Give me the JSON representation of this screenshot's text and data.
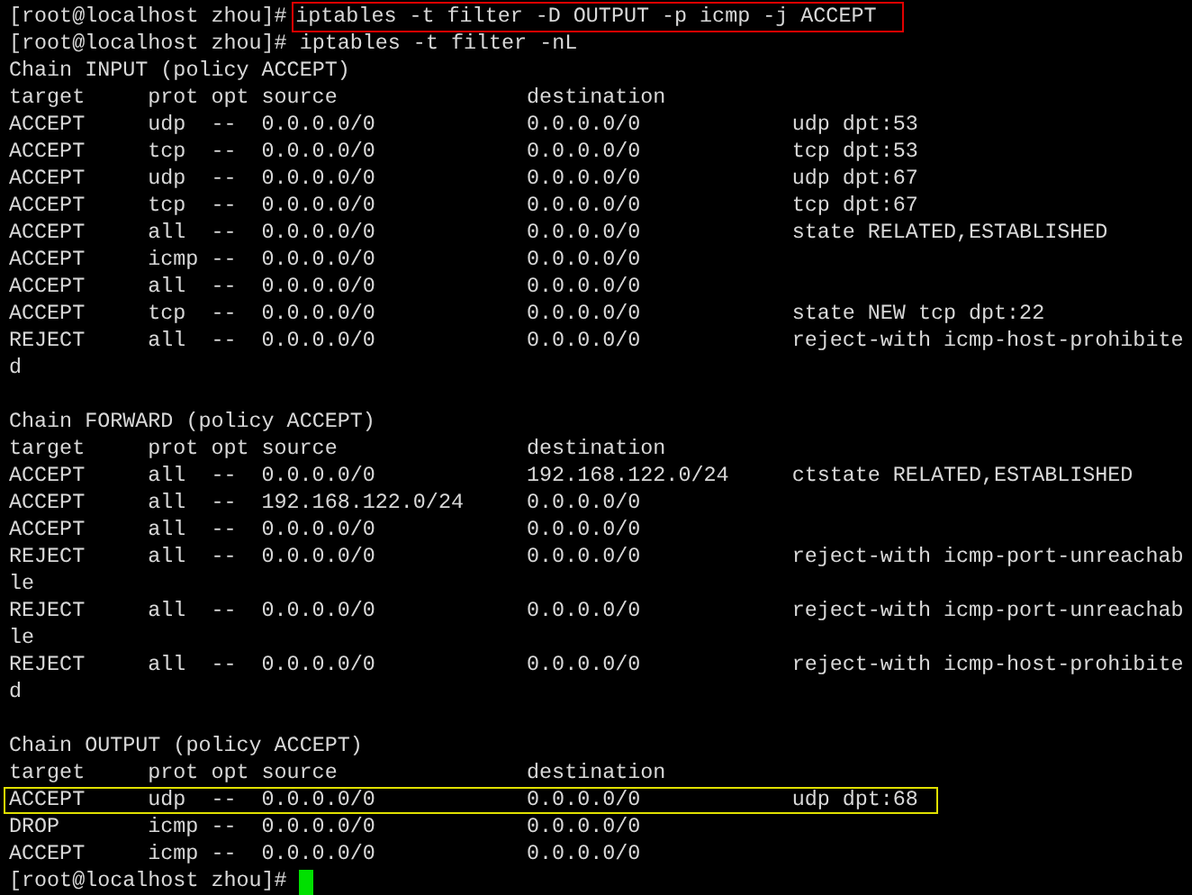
{
  "terminal": {
    "lines": [
      {
        "kind": "command",
        "prompt": "[root@localhost zhou]#",
        "command": "iptables -t filter -D OUTPUT -p icmp -j ACCEPT",
        "highlighted": true
      },
      {
        "kind": "command",
        "prompt": "[root@localhost zhou]#",
        "command": "iptables -t filter -nL"
      },
      {
        "kind": "text",
        "text": "Chain INPUT (policy ACCEPT)"
      },
      {
        "kind": "row",
        "cells": [
          "target",
          "prot",
          "opt",
          "source",
          "destination"
        ]
      },
      {
        "kind": "row",
        "cells": [
          "ACCEPT",
          "udp",
          "--",
          "0.0.0.0/0",
          "0.0.0.0/0",
          "udp dpt:53"
        ]
      },
      {
        "kind": "row",
        "cells": [
          "ACCEPT",
          "tcp",
          "--",
          "0.0.0.0/0",
          "0.0.0.0/0",
          "tcp dpt:53"
        ]
      },
      {
        "kind": "row",
        "cells": [
          "ACCEPT",
          "udp",
          "--",
          "0.0.0.0/0",
          "0.0.0.0/0",
          "udp dpt:67"
        ]
      },
      {
        "kind": "row",
        "cells": [
          "ACCEPT",
          "tcp",
          "--",
          "0.0.0.0/0",
          "0.0.0.0/0",
          "tcp dpt:67"
        ]
      },
      {
        "kind": "row",
        "cells": [
          "ACCEPT",
          "all",
          "--",
          "0.0.0.0/0",
          "0.0.0.0/0",
          "state RELATED,ESTABLISHED"
        ]
      },
      {
        "kind": "row",
        "cells": [
          "ACCEPT",
          "icmp",
          "--",
          "0.0.0.0/0",
          "0.0.0.0/0"
        ]
      },
      {
        "kind": "row",
        "cells": [
          "ACCEPT",
          "all",
          "--",
          "0.0.0.0/0",
          "0.0.0.0/0"
        ]
      },
      {
        "kind": "row",
        "cells": [
          "ACCEPT",
          "tcp",
          "--",
          "0.0.0.0/0",
          "0.0.0.0/0",
          "state NEW tcp dpt:22"
        ]
      },
      {
        "kind": "row",
        "cells": [
          "REJECT",
          "all",
          "--",
          "0.0.0.0/0",
          "0.0.0.0/0",
          "reject-with icmp-host-prohibite"
        ]
      },
      {
        "kind": "text",
        "text": "d"
      },
      {
        "kind": "blank"
      },
      {
        "kind": "text",
        "text": "Chain FORWARD (policy ACCEPT)"
      },
      {
        "kind": "row",
        "cells": [
          "target",
          "prot",
          "opt",
          "source",
          "destination"
        ]
      },
      {
        "kind": "row",
        "cells": [
          "ACCEPT",
          "all",
          "--",
          "0.0.0.0/0",
          "192.168.122.0/24",
          "ctstate RELATED,ESTABLISHED"
        ]
      },
      {
        "kind": "row",
        "cells": [
          "ACCEPT",
          "all",
          "--",
          "192.168.122.0/24",
          "0.0.0.0/0"
        ]
      },
      {
        "kind": "row",
        "cells": [
          "ACCEPT",
          "all",
          "--",
          "0.0.0.0/0",
          "0.0.0.0/0"
        ]
      },
      {
        "kind": "row",
        "cells": [
          "REJECT",
          "all",
          "--",
          "0.0.0.0/0",
          "0.0.0.0/0",
          "reject-with icmp-port-unreachab"
        ]
      },
      {
        "kind": "text",
        "text": "le"
      },
      {
        "kind": "row",
        "cells": [
          "REJECT",
          "all",
          "--",
          "0.0.0.0/0",
          "0.0.0.0/0",
          "reject-with icmp-port-unreachab"
        ]
      },
      {
        "kind": "text",
        "text": "le"
      },
      {
        "kind": "row",
        "cells": [
          "REJECT",
          "all",
          "--",
          "0.0.0.0/0",
          "0.0.0.0/0",
          "reject-with icmp-host-prohibite"
        ]
      },
      {
        "kind": "text",
        "text": "d"
      },
      {
        "kind": "blank"
      },
      {
        "kind": "text",
        "text": "Chain OUTPUT (policy ACCEPT)"
      },
      {
        "kind": "row",
        "cells": [
          "target",
          "prot",
          "opt",
          "source",
          "destination"
        ]
      },
      {
        "kind": "row",
        "cells": [
          "ACCEPT",
          "udp",
          "--",
          "0.0.0.0/0",
          "0.0.0.0/0",
          "udp dpt:68"
        ],
        "highlighted": true
      },
      {
        "kind": "row",
        "cells": [
          "DROP",
          "icmp",
          "--",
          "0.0.0.0/0",
          "0.0.0.0/0"
        ]
      },
      {
        "kind": "row",
        "cells": [
          "ACCEPT",
          "icmp",
          "--",
          "0.0.0.0/0",
          "0.0.0.0/0"
        ]
      },
      {
        "kind": "command",
        "prompt": "[root@localhost zhou]#",
        "cursor": true
      }
    ]
  }
}
